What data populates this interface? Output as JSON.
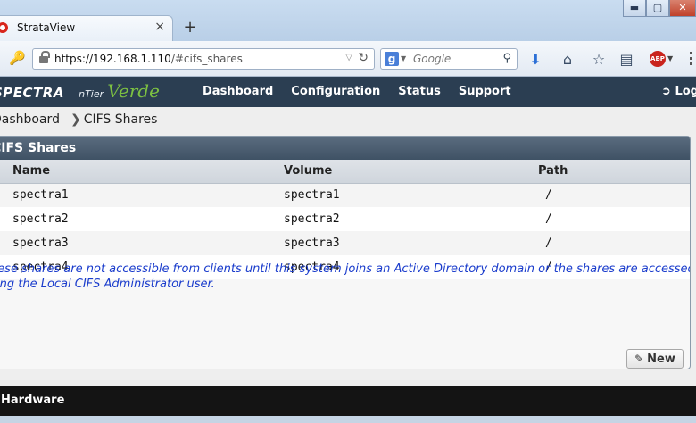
{
  "browser": {
    "tab_title": "StrataView",
    "tab_close": "×",
    "new_tab": "+",
    "url_host": "https://192.168.1.110",
    "url_path": "/#cifs_shares",
    "search_placeholder": "Google",
    "window_controls": [
      "minimize",
      "maximize",
      "close"
    ]
  },
  "app": {
    "logo_brand": "SPECTRA",
    "logo_product_prefix": "nTier",
    "logo_product": "Verde",
    "nav": [
      "Dashboard",
      "Configuration",
      "Status",
      "Support"
    ],
    "logout_label": "Log"
  },
  "breadcrumb": {
    "parent": "Dashboard",
    "current": "CIFS Shares"
  },
  "panel": {
    "title": "CIFS Shares",
    "columns": [
      "Name",
      "Volume",
      "Path"
    ],
    "rows": [
      [
        "spectra1",
        "spectra1",
        "/"
      ],
      [
        "spectra2",
        "spectra2",
        "/"
      ],
      [
        "spectra3",
        "spectra3",
        "/"
      ],
      [
        "spectra4",
        "spectra4",
        "/"
      ]
    ],
    "notice_line1": "These shares are not accessible from clients until this system joins an Active Directory domain or the shares are accessed",
    "notice_line2": "using the Local CIFS Administrator user.",
    "new_button": "New"
  },
  "footer": {
    "section": "Hardware"
  },
  "colors": {
    "app_header": "#2b3e52",
    "panel_header": "#4a5d70",
    "notice_text": "#1a3ccc",
    "footer": "#141414"
  }
}
